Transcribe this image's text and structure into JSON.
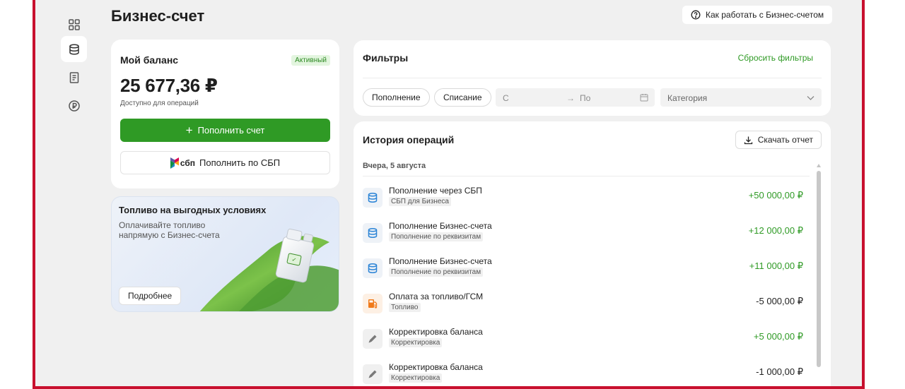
{
  "page": {
    "title": "Бизнес-счет",
    "help_label": "Как работать с Бизнес-счетом"
  },
  "nav": {
    "items": [
      {
        "icon": "grid-icon",
        "active": false
      },
      {
        "icon": "database-icon",
        "active": true
      },
      {
        "icon": "document-icon",
        "active": false
      },
      {
        "icon": "ruble-icon",
        "active": false
      }
    ]
  },
  "balance": {
    "title": "Мой баланс",
    "status": "Активный",
    "amount": "25 677,36 ₽",
    "subtitle": "Доступно для операций",
    "topup_label": "Пополнить счет",
    "sbp_word": "сбп",
    "sbp_label": "Пополнить по СБП"
  },
  "promo": {
    "title": "Топливо на выгодных условиях",
    "text": "Оплачивайте топливо напрямую с Бизнес-счета",
    "more_label": "Подробнее"
  },
  "filters": {
    "title": "Фильтры",
    "reset_label": "Сбросить фильтры",
    "chips": [
      "Пополнение",
      "Списание"
    ],
    "date_from_placeholder": "С",
    "date_to_placeholder": "По",
    "category_placeholder": "Категория"
  },
  "history": {
    "title": "История операций",
    "download_label": "Скачать отчет",
    "day_label": "Вчера, 5 августа",
    "transactions": [
      {
        "title": "Пополнение через СБП",
        "tag": "СБП для Бизнеса",
        "amount": "+50 000,00 ₽",
        "sign": "pos",
        "icon": "database-icon"
      },
      {
        "title": "Пополнение Бизнес-счета",
        "tag": "Пополнение по реквизитам",
        "amount": "+12 000,00 ₽",
        "sign": "pos",
        "icon": "database-icon"
      },
      {
        "title": "Пополнение Бизнес-счета",
        "tag": "Пополнение по реквизитам",
        "amount": "+11 000,00 ₽",
        "sign": "pos",
        "icon": "database-icon"
      },
      {
        "title": "Оплата за топливо/ГСМ",
        "tag": "Топливо",
        "amount": "-5 000,00 ₽",
        "sign": "neg",
        "icon": "fuel-pump-icon"
      },
      {
        "title": "Корректировка баланса",
        "tag": "Корректировка",
        "amount": "+5 000,00 ₽",
        "sign": "pos",
        "icon": "pencil-icon"
      },
      {
        "title": "Корректировка баланса",
        "tag": "Корректировка",
        "amount": "-1 000,00 ₽",
        "sign": "neg",
        "icon": "pencil-icon"
      }
    ]
  },
  "colors": {
    "brand_frame": "#c8102e",
    "accent_green": "#2f9a25",
    "background": "#f0f0f0"
  }
}
